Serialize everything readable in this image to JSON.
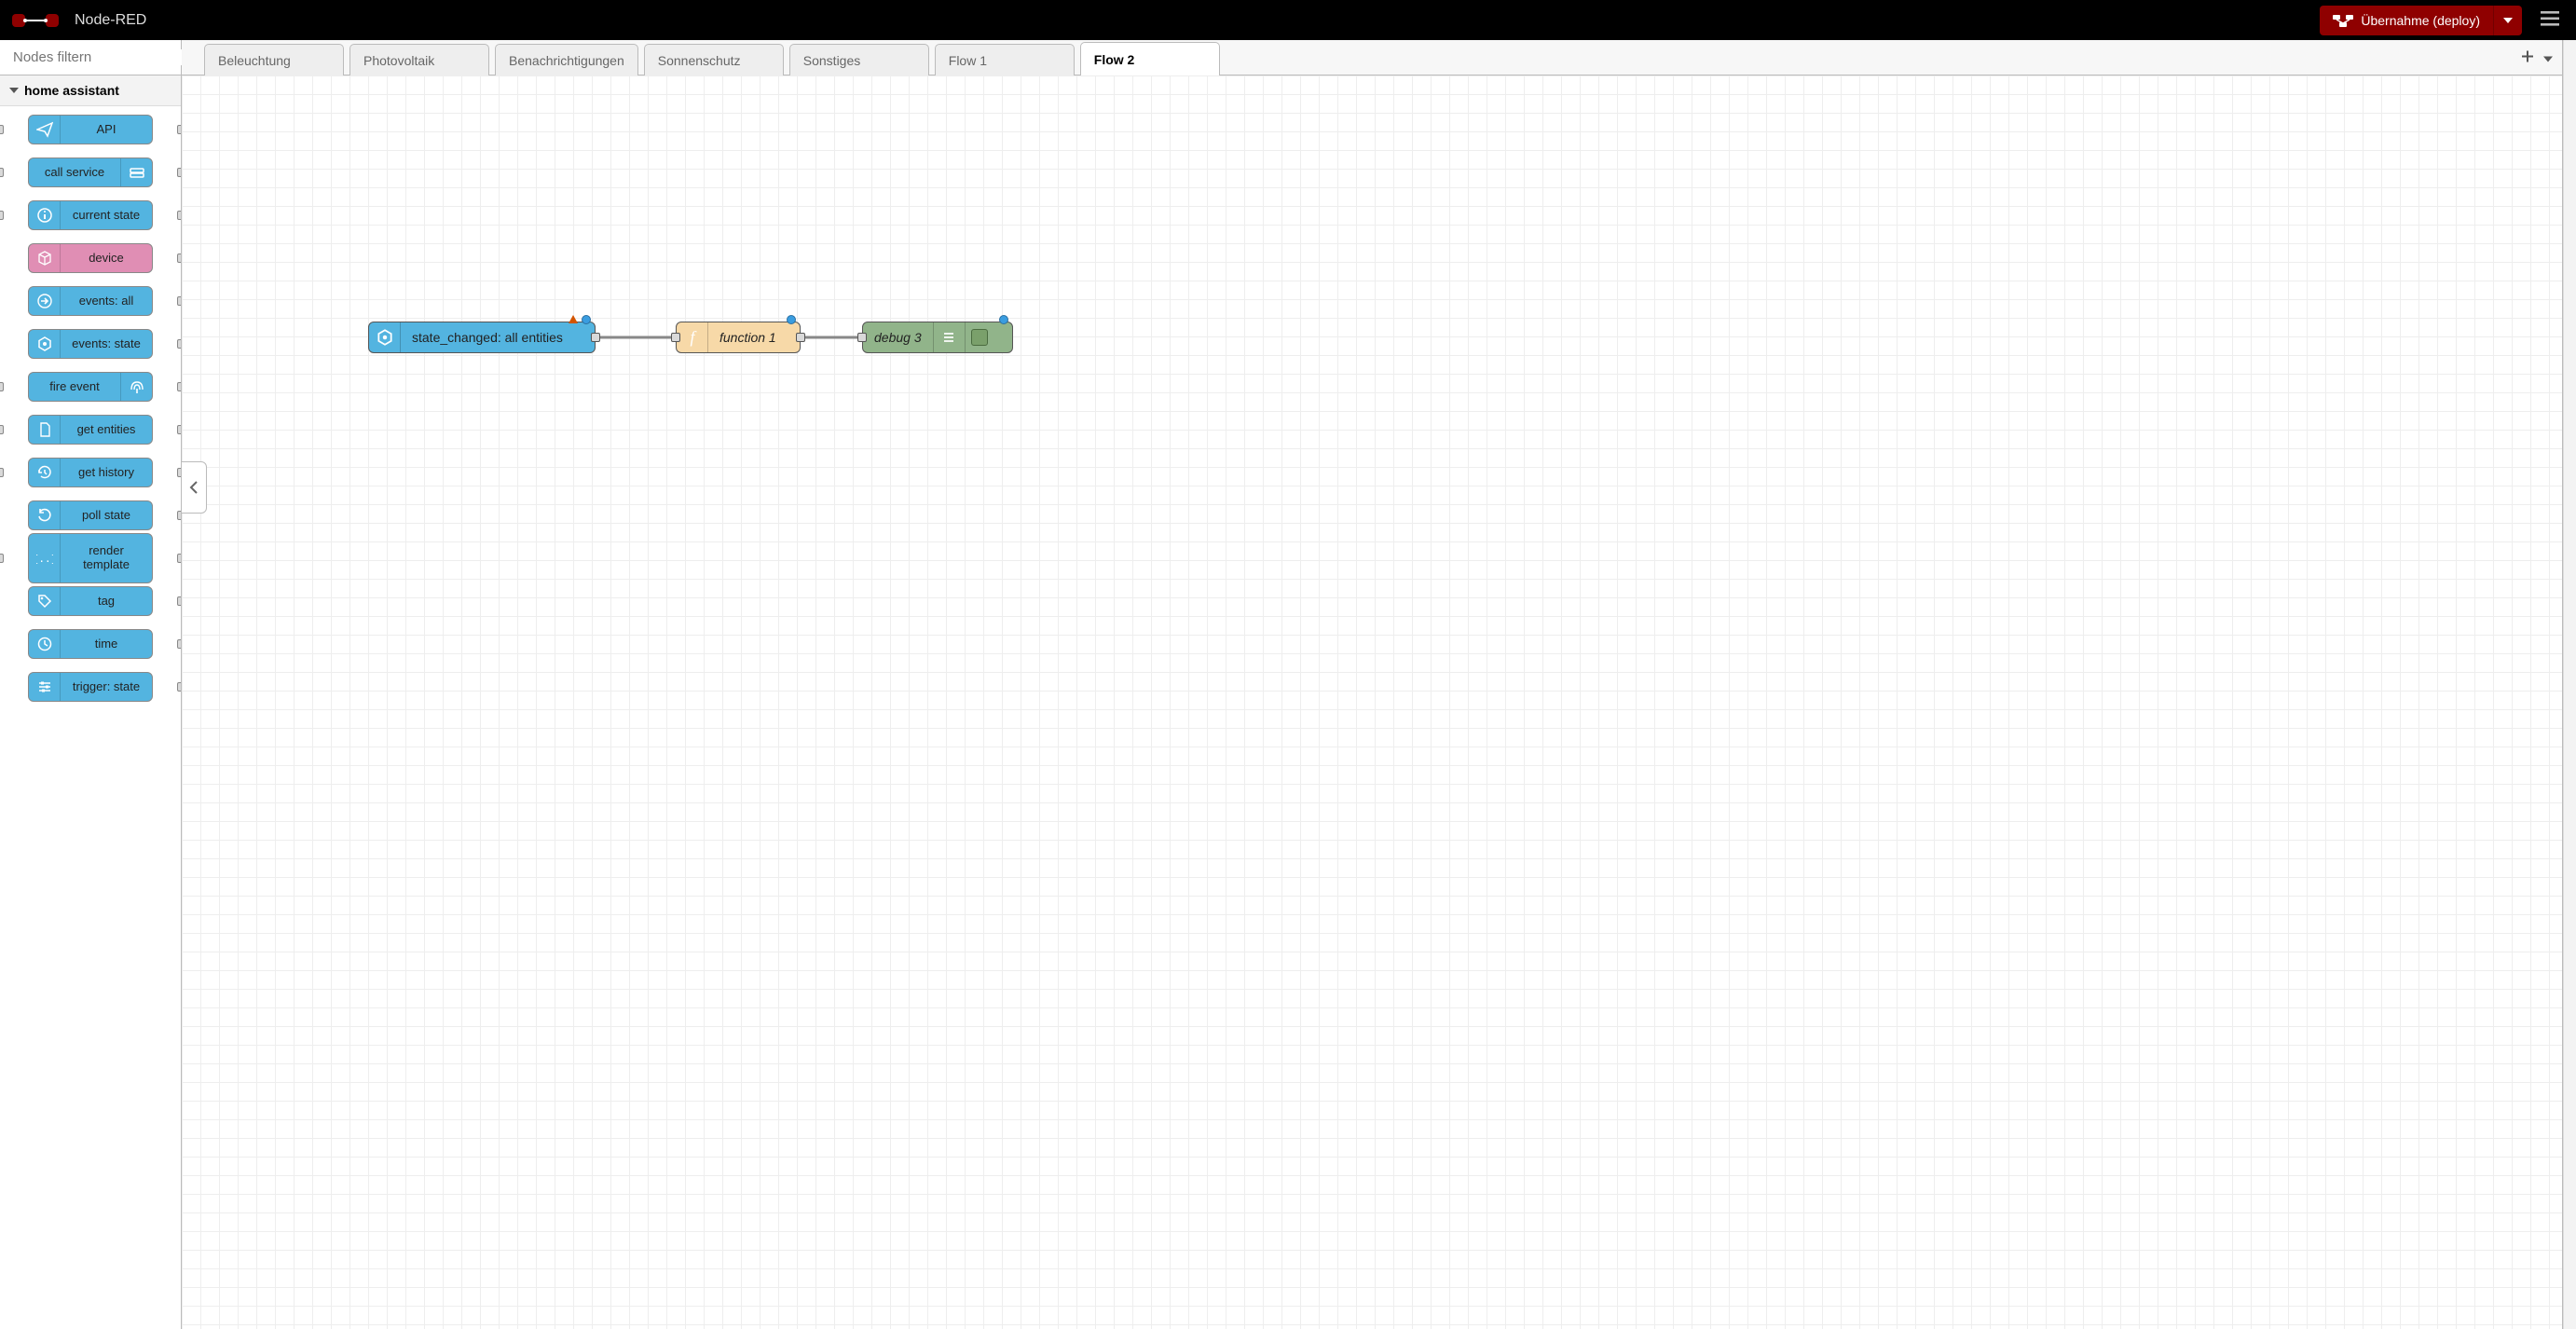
{
  "header": {
    "title": "Node-RED",
    "deploy_label": "Übernahme (deploy)"
  },
  "palette": {
    "search_placeholder": "Nodes filtern",
    "category": "home assistant",
    "nodes": [
      {
        "label": "API"
      },
      {
        "label": "call service"
      },
      {
        "label": "current state"
      },
      {
        "label": "device"
      },
      {
        "label": "events: all"
      },
      {
        "label": "events: state"
      },
      {
        "label": "fire event"
      },
      {
        "label": "get entities"
      },
      {
        "label": "get history"
      },
      {
        "label": "poll state"
      },
      {
        "label": "render template"
      },
      {
        "label": "tag"
      },
      {
        "label": "time"
      },
      {
        "label": "trigger: state"
      }
    ]
  },
  "tabs": [
    {
      "label": "Beleuchtung"
    },
    {
      "label": "Photovoltaik"
    },
    {
      "label": "Benachrichtigungen"
    },
    {
      "label": "Sonnenschutz"
    },
    {
      "label": "Sonstiges"
    },
    {
      "label": "Flow 1"
    },
    {
      "label": "Flow 2"
    }
  ],
  "active_tab_index": 6,
  "flow_nodes": {
    "events_all": {
      "label": "state_changed: all entities"
    },
    "function": {
      "label": "function 1"
    },
    "debug": {
      "label": "debug 3"
    }
  }
}
